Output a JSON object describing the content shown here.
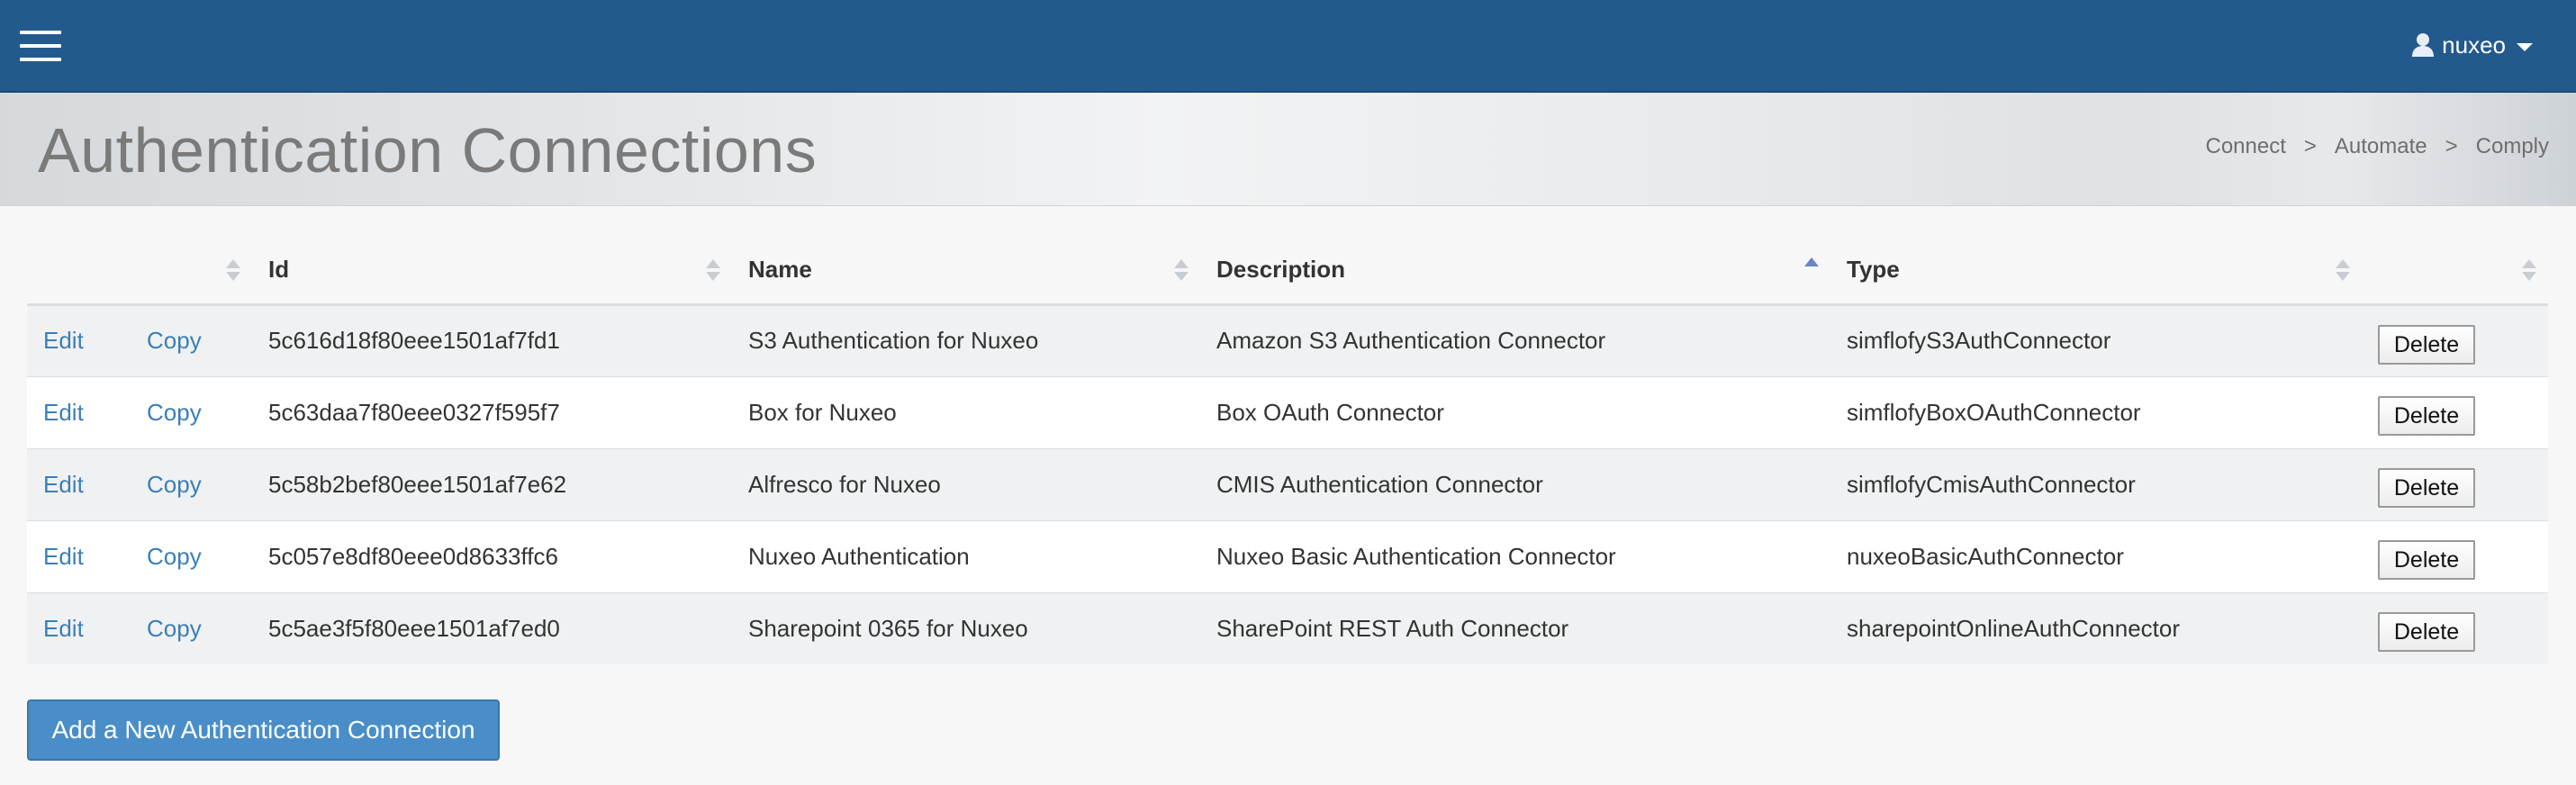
{
  "header": {
    "user_name": "nuxeo"
  },
  "page": {
    "title": "Authentication Connections",
    "breadcrumb": [
      "Connect",
      "Automate",
      "Comply"
    ],
    "breadcrumb_separator": ">"
  },
  "table": {
    "columns": {
      "id": "Id",
      "name": "Name",
      "description": "Description",
      "type": "Type"
    },
    "sorted_column": "description",
    "sort_direction": "ascending",
    "edit_label": "Edit",
    "copy_label": "Copy",
    "delete_label": "Delete",
    "rows": [
      {
        "id": "5c616d18f80eee1501af7fd1",
        "name": "S3 Authentication for Nuxeo",
        "description": "Amazon S3 Authentication Connector",
        "type": "simflofyS3AuthConnector"
      },
      {
        "id": "5c63daa7f80eee0327f595f7",
        "name": "Box for Nuxeo",
        "description": "Box OAuth Connector",
        "type": "simflofyBoxOAuthConnector"
      },
      {
        "id": "5c58b2bef80eee1501af7e62",
        "name": "Alfresco for Nuxeo",
        "description": "CMIS Authentication Connector",
        "type": "simflofyCmisAuthConnector"
      },
      {
        "id": "5c057e8df80eee0d8633ffc6",
        "name": "Nuxeo Authentication",
        "description": "Nuxeo Basic Authentication Connector",
        "type": "nuxeoBasicAuthConnector"
      },
      {
        "id": "5c5ae3f5f80eee1501af7ed0",
        "name": "Sharepoint 0365 for Nuxeo",
        "description": "SharePoint REST Auth Connector",
        "type": "sharepointOnlineAuthConnector"
      }
    ]
  },
  "actions": {
    "add_label": "Add a New Authentication Connection"
  },
  "colors": {
    "navbar": "#225a8e",
    "link": "#3a7fb8",
    "primary_button": "#4a8ec9",
    "sort_active": "#6a84c7"
  },
  "icons": {
    "menu": "hamburger-menu-icon",
    "user": "user-icon",
    "dropdown": "caret-down-icon",
    "sort": "sort-icon"
  }
}
